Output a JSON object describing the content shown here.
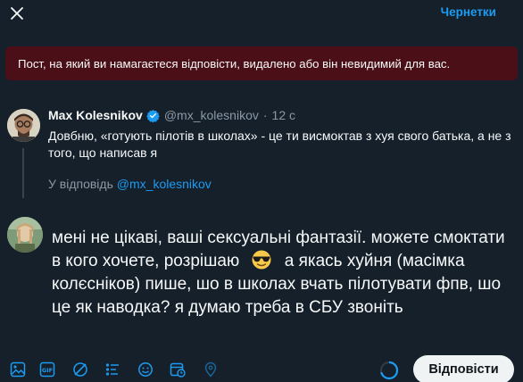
{
  "header": {
    "drafts_label": "Чернетки"
  },
  "alert": {
    "text": "Пост, на який ви намагаєтеся відповісти, видалено або він невидимий для вас."
  },
  "quoted_post": {
    "author": "Max Kolesnikov",
    "handle": "@mx_kolesnikov",
    "separator": "·",
    "time": "12 с",
    "text": "Довбню, «готують пілотів в школах» - це ти висмоктав з хуя свого батька, а не з того, що написав я",
    "reply_prefix": "У відповідь",
    "reply_mention": "@mx_kolesnikov"
  },
  "draft": {
    "text_before_emoji": "мені не цікаві, ваші сексуальні фантазії. можете смоктати в кого хочете, розрішаю",
    "text_after_emoji": "а якась хуйня (масімка колєсніков) пише, шо в школах вчать пілотувати фпв, шо це як наводка? я думаю треба в СБУ звоніть"
  },
  "toolbar": {
    "icons": [
      "media-icon",
      "gif-icon",
      "grok-icon",
      "poll-icon",
      "emoji-icon",
      "schedule-icon",
      "location-icon"
    ],
    "reply_button_label": "Відповісти"
  },
  "colors": {
    "accent": "#1d9bf0",
    "background": "#15202b",
    "alert_bg": "#4b0f18",
    "muted": "#8b98a5"
  }
}
